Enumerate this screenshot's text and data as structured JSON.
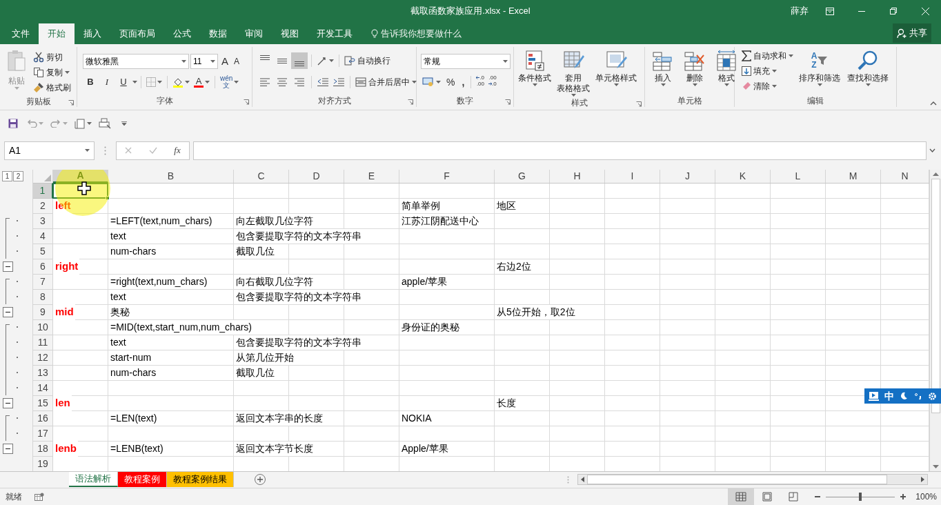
{
  "window": {
    "title": "截取函数家族应用.xlsx - Excel",
    "user": "薛弃"
  },
  "menu_tabs": [
    {
      "label": "文件",
      "selected": false
    },
    {
      "label": "开始",
      "selected": true
    },
    {
      "label": "插入",
      "selected": false
    },
    {
      "label": "页面布局",
      "selected": false
    },
    {
      "label": "公式",
      "selected": false
    },
    {
      "label": "数据",
      "selected": false
    },
    {
      "label": "审阅",
      "selected": false
    },
    {
      "label": "视图",
      "selected": false
    },
    {
      "label": "开发工具",
      "selected": false
    }
  ],
  "tell_me": {
    "placeholder": "告诉我你想要做什么"
  },
  "share": "共享",
  "ribbon": {
    "clipboard": {
      "label": "剪贴板",
      "paste": "粘贴",
      "cut": "剪切",
      "copy": "复制",
      "format_painter": "格式刷"
    },
    "font": {
      "label": "字体",
      "font_name": "微软雅黑",
      "font_size": "11",
      "grow": "A",
      "shrink": "A",
      "bold": "B",
      "italic": "I",
      "underline": "U",
      "font_color": "A",
      "phonetic": [
        "wén",
        "文"
      ]
    },
    "alignment": {
      "label": "对齐方式",
      "vertical": [
        {
          "kind": "top",
          "selected": false
        },
        {
          "kind": "middle",
          "selected": false
        },
        {
          "kind": "bottom",
          "selected": true
        }
      ],
      "wrap_text": "自动换行",
      "merge": "合并后居中"
    },
    "number": {
      "label": "数字",
      "format": "常规",
      "percent": "%",
      "comma": ",",
      "decrease_decimal": [
        ".0",
        ".00"
      ],
      "increase_decimal": [
        ".00",
        ".0"
      ]
    },
    "styles": {
      "label": "样式",
      "conditional": "条件格式",
      "table": [
        "套用",
        "表格格式"
      ],
      "cell_styles": "单元格样式"
    },
    "cells": {
      "label": "单元格",
      "insert": "插入",
      "delete": "删除",
      "format": "格式"
    },
    "editing": {
      "label": "编辑",
      "autosum": "自动求和",
      "fill": "填充",
      "clear": "清除",
      "sort": "排序和筛选",
      "sort_letters": [
        "A",
        "Z"
      ],
      "find": "查找和选择"
    }
  },
  "name_box": "A1",
  "formula_bar": {
    "fx": "fx"
  },
  "outline_levels": [
    "1",
    "2"
  ],
  "columns": [
    {
      "label": "A",
      "selected": true
    },
    {
      "label": "B",
      "selected": false
    },
    {
      "label": "C",
      "selected": false
    },
    {
      "label": "D",
      "selected": false
    },
    {
      "label": "E",
      "selected": false
    },
    {
      "label": "F",
      "selected": false
    },
    {
      "label": "G",
      "selected": false
    },
    {
      "label": "H",
      "selected": false
    },
    {
      "label": "I",
      "selected": false
    },
    {
      "label": "J",
      "selected": false
    },
    {
      "label": "K",
      "selected": false
    },
    {
      "label": "L",
      "selected": false
    },
    {
      "label": "M",
      "selected": false
    },
    {
      "label": "N",
      "selected": false
    }
  ],
  "rows": [
    {
      "label": "1",
      "selected": true,
      "kind": "plain"
    },
    {
      "label": "2",
      "selected": false,
      "kind": "plain",
      "cells": {
        "A": "left",
        "F": "简单举例",
        "G": "地区"
      }
    },
    {
      "label": "3",
      "selected": false,
      "kind": "detail",
      "cells": {
        "B": "=LEFT(text,num_chars)",
        "C": "向左截取几位字符",
        "F": "江苏江阴配送中心"
      }
    },
    {
      "label": "4",
      "selected": false,
      "kind": "detail",
      "cells": {
        "B": "text",
        "C": "包含要提取字符的文本字符串"
      }
    },
    {
      "label": "5",
      "selected": false,
      "kind": "detail",
      "cells": {
        "B": "num-chars",
        "C": "截取几位"
      }
    },
    {
      "label": "6",
      "selected": false,
      "kind": "summary",
      "expanded": true,
      "cells": {
        "A": "right",
        "G": "右边2位"
      }
    },
    {
      "label": "7",
      "selected": false,
      "kind": "detail",
      "cells": {
        "B": "=right(text,num_chars)",
        "C": "向右截取几位字符",
        "F": "apple/苹果"
      }
    },
    {
      "label": "8",
      "selected": false,
      "kind": "detail",
      "cells": {
        "B": "text",
        "C": "包含要提取字符的文本字符串"
      }
    },
    {
      "label": "9",
      "selected": false,
      "kind": "summary",
      "expanded": true,
      "cells": {
        "A": "mid",
        "B": "奥秘",
        "G": "从5位开始，取2位"
      }
    },
    {
      "label": "10",
      "selected": false,
      "kind": "detail",
      "cells": {
        "B": "=MID(text,start_num,num_chars)",
        "F": "身份证的奥秘"
      }
    },
    {
      "label": "11",
      "selected": false,
      "kind": "detail",
      "cells": {
        "B": "text",
        "C": "包含要提取字符的文本字符串"
      }
    },
    {
      "label": "12",
      "selected": false,
      "kind": "detail",
      "cells": {
        "B": "start-num",
        "C": "从第几位开始"
      }
    },
    {
      "label": "13",
      "selected": false,
      "kind": "detail",
      "cells": {
        "B": "num-chars",
        "C": "截取几位"
      }
    },
    {
      "label": "14",
      "selected": false,
      "kind": "detail"
    },
    {
      "label": "15",
      "selected": false,
      "kind": "summary",
      "expanded": true,
      "cells": {
        "A": "len",
        "G": "长度"
      }
    },
    {
      "label": "16",
      "selected": false,
      "kind": "detail",
      "cells": {
        "B": "=LEN(text)",
        "C": "返回文本字串的长度",
        "F": "NOKIA"
      }
    },
    {
      "label": "17",
      "selected": false,
      "kind": "detail"
    },
    {
      "label": "18",
      "selected": false,
      "kind": "summary",
      "expanded": true,
      "cells": {
        "A": "lenb",
        "B": "=LENB(text)",
        "C": "返回文本字节长度",
        "F": "Apple/苹果"
      }
    },
    {
      "label": "19",
      "selected": false,
      "kind": "plain"
    }
  ],
  "sheets": [
    {
      "label": "语法解析",
      "selected": true
    },
    {
      "label": "教程案例",
      "selected": false,
      "color": "#ff0000"
    },
    {
      "label": "教程案例结果",
      "selected": false,
      "color": "#ffc000"
    }
  ],
  "ime_toolbar": {
    "mode": "中"
  },
  "status_bar": {
    "status": "就绪",
    "views": [
      {
        "kind": "normal",
        "selected": true
      },
      {
        "kind": "page_layout",
        "selected": false
      },
      {
        "kind": "page_break",
        "selected": false
      }
    ],
    "zoom": {
      "level": 0.5,
      "reading": "100%"
    }
  }
}
